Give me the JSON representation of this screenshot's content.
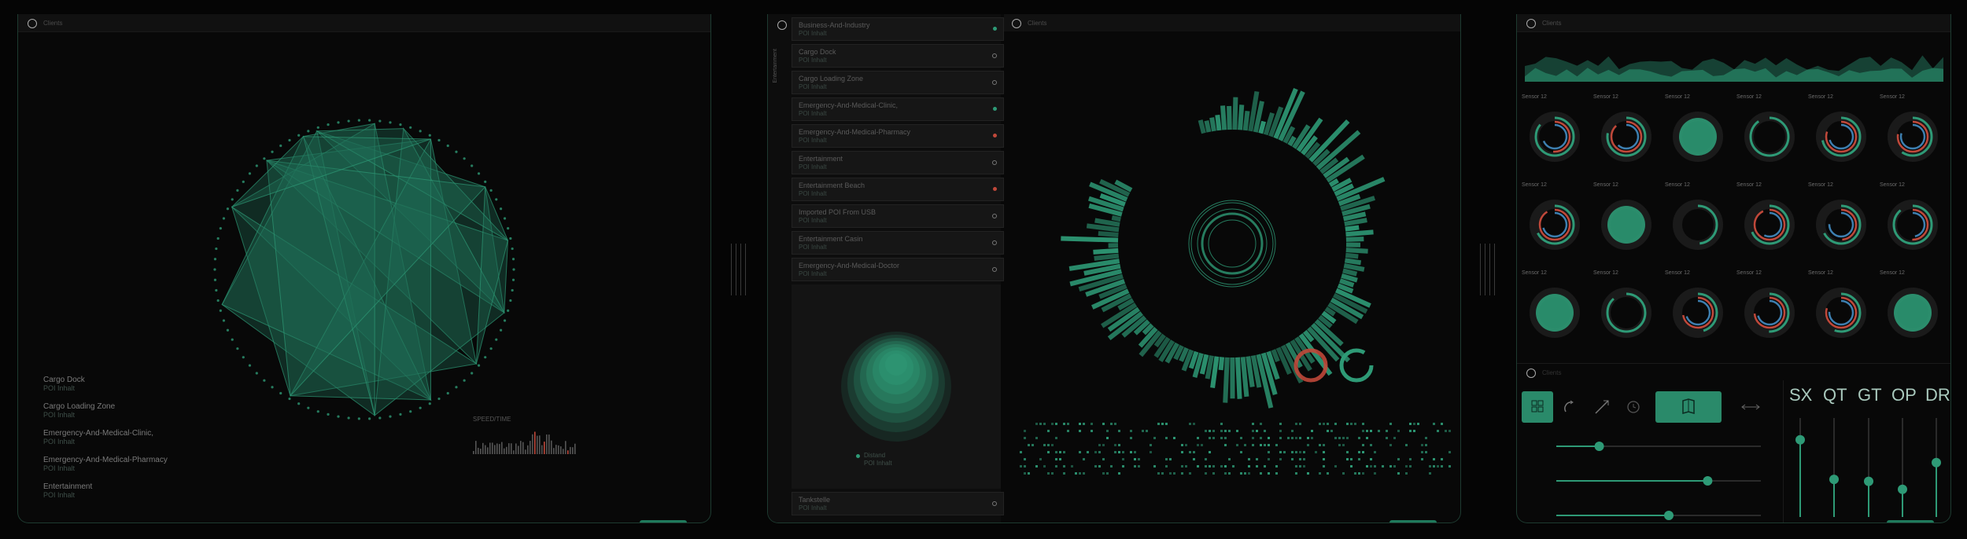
{
  "panel_title": "Clients",
  "left_panel": {
    "legend": [
      {
        "label": "Cargo Dock",
        "sub": "POI Inhalt"
      },
      {
        "label": "Cargo Loading Zone",
        "sub": "POI Inhalt"
      },
      {
        "label": "Emergency-And-Medical-Clinic,",
        "sub": "POI Inhalt"
      },
      {
        "label": "Emergency-And-Medical-Pharmacy",
        "sub": "POI Inhalt"
      },
      {
        "label": "Entertainment",
        "sub": "POI Inhalt"
      }
    ],
    "histogram_label": "SPEED/TIME"
  },
  "mid_sidebar": {
    "vertical_tab": "Entertainment",
    "items": [
      {
        "title": "Business-And-Industry",
        "sub": "POI Inhalt",
        "status": "green"
      },
      {
        "title": "Cargo Dock",
        "sub": "POI Inhalt",
        "status": "off"
      },
      {
        "title": "Cargo Loading Zone",
        "sub": "POI Inhalt",
        "status": "off"
      },
      {
        "title": "Emergency-And-Medical-Clinic,",
        "sub": "POI Inhalt",
        "status": "green"
      },
      {
        "title": "Emergency-And-Medical-Pharmacy",
        "sub": "POI Inhalt",
        "status": "red"
      },
      {
        "title": "Entertainment",
        "sub": "POI Inhalt",
        "status": "off"
      },
      {
        "title": "Entertainment Beach",
        "sub": "POI Inhalt",
        "status": "red"
      },
      {
        "title": "Imported POI From USB",
        "sub": "POI Inhalt",
        "status": "off"
      },
      {
        "title": "Entertainment Casin",
        "sub": "POI Inhalt",
        "status": "off"
      },
      {
        "title": "Emergency-And-Medical-Doctor",
        "sub": "POI Inhalt",
        "status": "off"
      }
    ],
    "glow_label": "Distand",
    "glow_sub": "POI Inhalt",
    "bottom_item": {
      "title": "Tankstelle",
      "sub": "POI Inhalt"
    }
  },
  "sensors": {
    "label": "Sensor 12",
    "count": 18
  },
  "faders": [
    "SX",
    "QT",
    "GT",
    "OP",
    "DR"
  ],
  "fader_levels": [
    0.78,
    0.38,
    0.36,
    0.28,
    0.55
  ],
  "slider_levels": [
    0.21,
    0.74,
    0.55
  ],
  "colors": {
    "accent": "#2e9a76",
    "accent_dark": "#1d5a47",
    "red": "#c0483a",
    "blue": "#3d7fb0",
    "bg": "#080808"
  }
}
